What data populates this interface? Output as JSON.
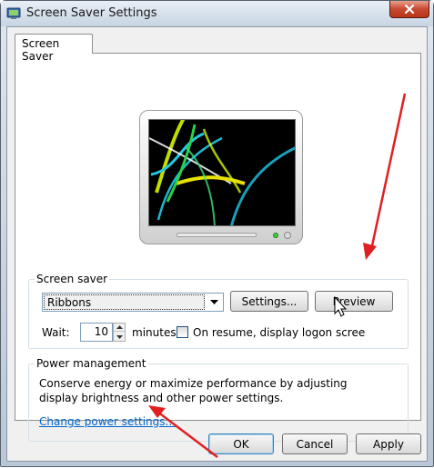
{
  "window": {
    "title": "Screen Saver Settings",
    "icons": {
      "app": "screensaver-app-icon",
      "close": "close-icon"
    }
  },
  "tabs": [
    {
      "label": "Screen Saver",
      "selected": true
    }
  ],
  "preview": {
    "screensaver_preview": "Ribbons",
    "icon": "monitor-preview"
  },
  "screen_saver_group": {
    "label": "Screen saver",
    "selected": "Ribbons",
    "settings_button": "Settings...",
    "preview_button": "Preview",
    "wait_label": "Wait:",
    "wait_value": "10",
    "minutes_label": "minutes",
    "on_resume_label": "On resume, display logon scree",
    "on_resume_checked": false
  },
  "power_group": {
    "label": "Power management",
    "description": "Conserve energy or maximize performance by adjusting display brightness and other power settings.",
    "link": "Change power settings..."
  },
  "footer": {
    "ok": "OK",
    "cancel": "Cancel",
    "apply": "Apply"
  },
  "annotations": {
    "arrow_color": "#e02020"
  }
}
